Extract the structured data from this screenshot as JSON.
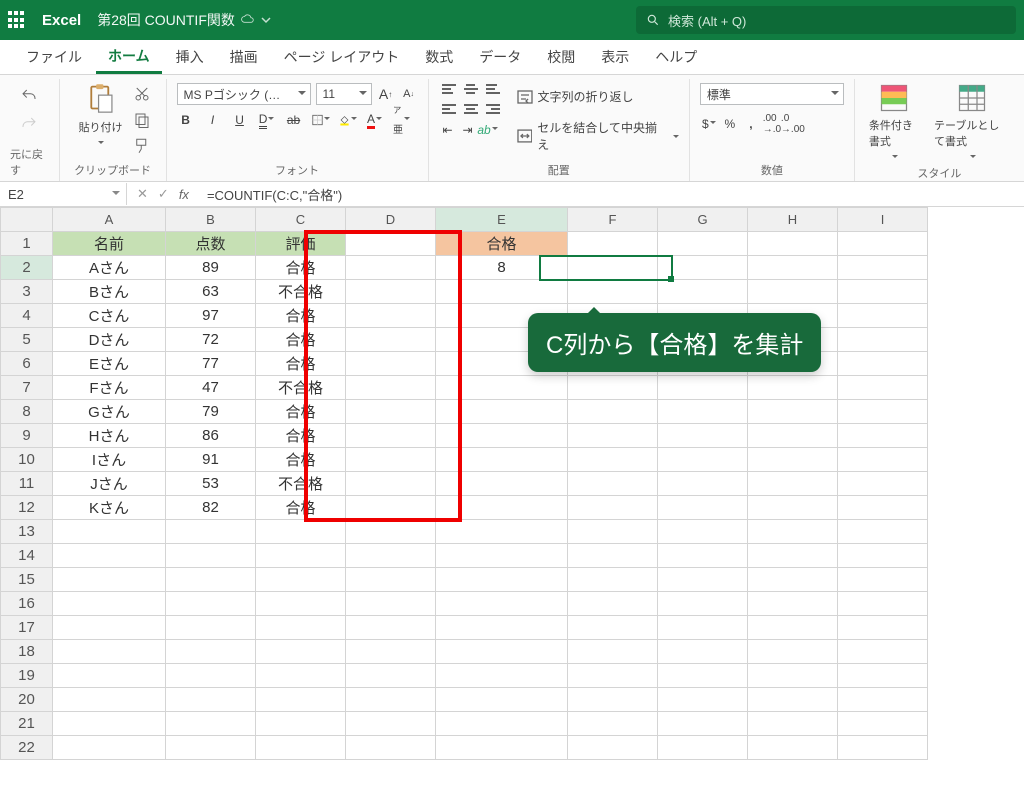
{
  "title": {
    "app": "Excel",
    "file": "第28回 COUNTIF関数"
  },
  "search": {
    "placeholder": "検索 (Alt + Q)"
  },
  "tabs": [
    "ファイル",
    "ホーム",
    "挿入",
    "描画",
    "ページ レイアウト",
    "数式",
    "データ",
    "校閲",
    "表示",
    "ヘルプ"
  ],
  "activeTab": 1,
  "ribbon": {
    "undo_label": "元に戻す",
    "clipboard_label": "クリップボード",
    "paste": "貼り付け",
    "font_label": "フォント",
    "font_name": "MS Pゴシック (…",
    "font_size": "11",
    "align_label": "配置",
    "wrap": "文字列の折り返し",
    "merge": "セルを結合して中央揃え",
    "number_label": "数値",
    "number_format": "標準",
    "style_label": "スタイル",
    "cond_format": "条件付き書式",
    "table_format": "テーブルとして書式"
  },
  "formula": {
    "cell": "E2",
    "text": "=COUNTIF(C:C,\"合格\")"
  },
  "columns": [
    "A",
    "B",
    "C",
    "D",
    "E",
    "F",
    "G",
    "H",
    "I"
  ],
  "headers": {
    "A": "名前",
    "B": "点数",
    "C": "評価"
  },
  "e1": "合格",
  "e2": "8",
  "rows": [
    {
      "n": 1
    },
    {
      "n": 2,
      "a": "Aさん",
      "b": "89",
      "c": "合格"
    },
    {
      "n": 3,
      "a": "Bさん",
      "b": "63",
      "c": "不合格"
    },
    {
      "n": 4,
      "a": "Cさん",
      "b": "97",
      "c": "合格"
    },
    {
      "n": 5,
      "a": "Dさん",
      "b": "72",
      "c": "合格"
    },
    {
      "n": 6,
      "a": "Eさん",
      "b": "77",
      "c": "合格"
    },
    {
      "n": 7,
      "a": "Fさん",
      "b": "47",
      "c": "不合格"
    },
    {
      "n": 8,
      "a": "Gさん",
      "b": "79",
      "c": "合格"
    },
    {
      "n": 9,
      "a": "Hさん",
      "b": "86",
      "c": "合格"
    },
    {
      "n": 10,
      "a": "Iさん",
      "b": "91",
      "c": "合格"
    },
    {
      "n": 11,
      "a": "Jさん",
      "b": "53",
      "c": "不合格"
    },
    {
      "n": 12,
      "a": "Kさん",
      "b": "82",
      "c": "合格"
    },
    {
      "n": 13
    },
    {
      "n": 14
    },
    {
      "n": 15
    },
    {
      "n": 16
    },
    {
      "n": 17
    },
    {
      "n": 18
    },
    {
      "n": 19
    },
    {
      "n": 20
    },
    {
      "n": 21
    },
    {
      "n": 22
    }
  ],
  "tooltip": "C列から【合格】を集計"
}
